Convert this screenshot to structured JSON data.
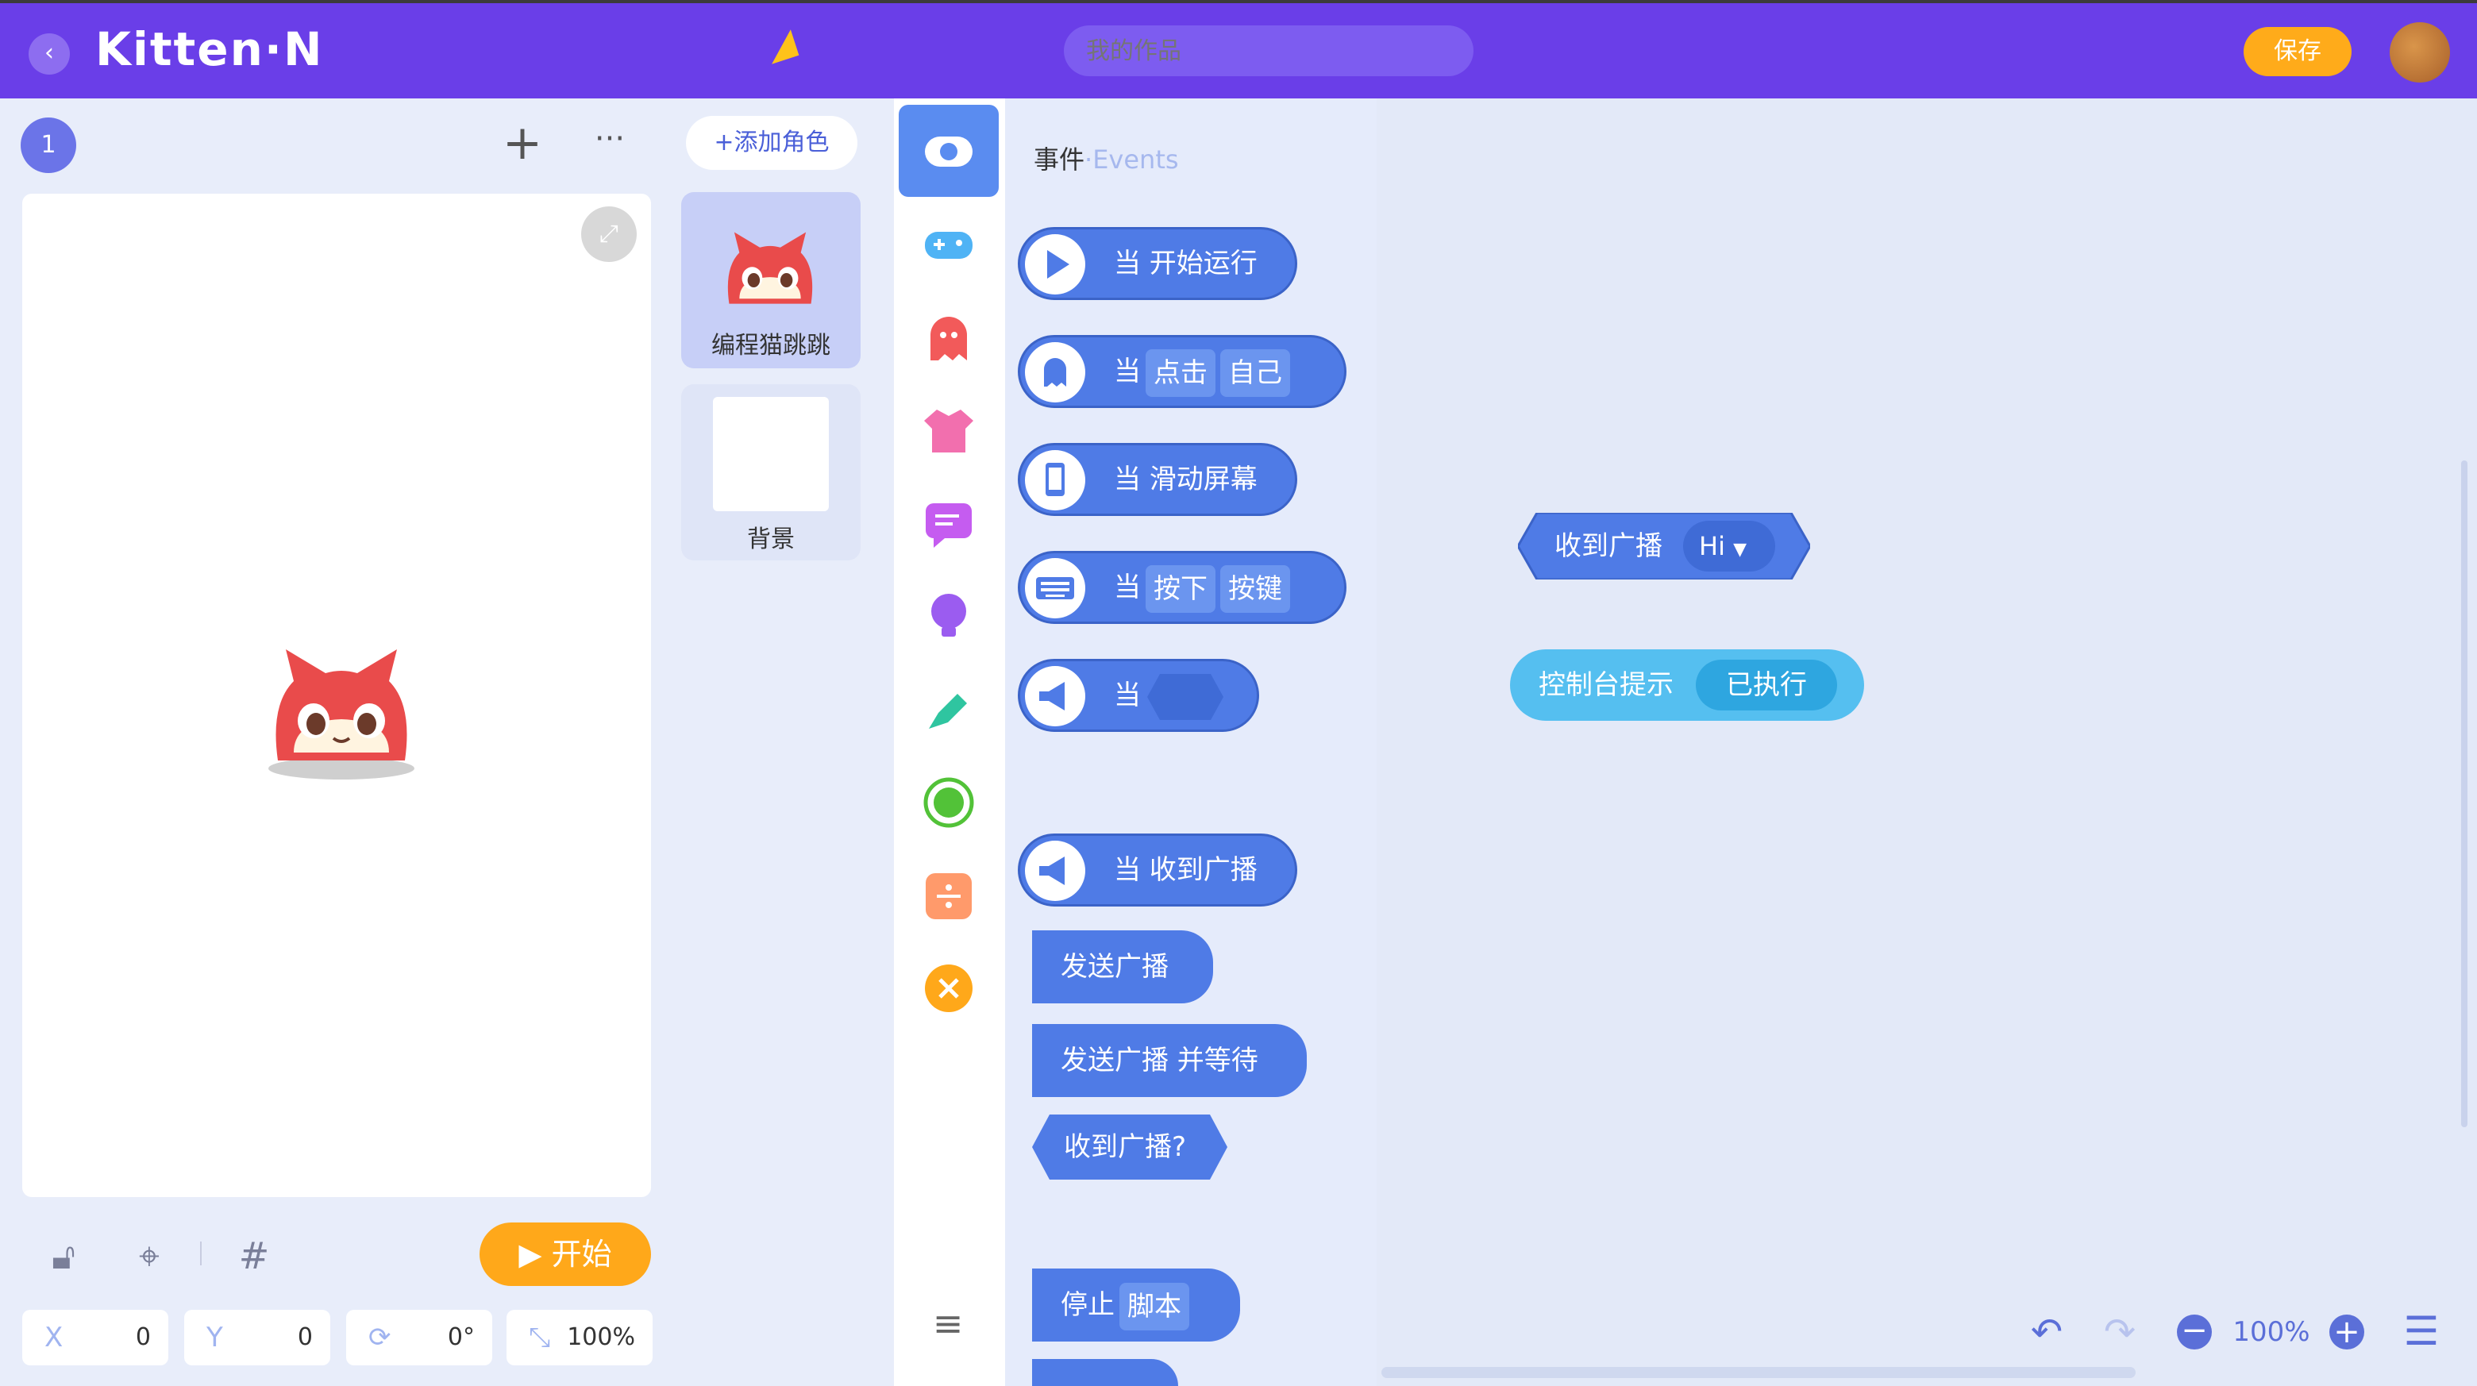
{
  "topbar": {
    "back_icon": "chevron-left-icon",
    "logo": "Kitten·N",
    "work_placeholder": "我的作品",
    "save_label": "保存",
    "avatar": "cookie-avatar"
  },
  "stage_panel": {
    "scene_number": "1",
    "start_label": "开始",
    "x_label": "X",
    "x_value": "0",
    "y_label": "Y",
    "y_value": "0",
    "rotation_value": "0°",
    "scale_value": "100%"
  },
  "sprites": {
    "add_label": "+添加角色",
    "sprite_name": "编程猫跳跳",
    "background_label": "背景"
  },
  "categories": [
    {
      "name": "events-icon",
      "color": "#5a8cf0"
    },
    {
      "name": "gamepad-icon",
      "color": "#4fb3f5"
    },
    {
      "name": "ghost-icon",
      "color": "#f25a5a"
    },
    {
      "name": "shirt-icon",
      "color": "#f26fae"
    },
    {
      "name": "chat-icon",
      "color": "#c55cf0"
    },
    {
      "name": "bulb-icon",
      "color": "#9b5cf0"
    },
    {
      "name": "pen-icon",
      "color": "#2fc5a0"
    },
    {
      "name": "circle-icon",
      "color": "#52c238"
    },
    {
      "name": "divide-icon",
      "color": "#ff9a6b"
    },
    {
      "name": "close-icon",
      "color": "#ffa81a"
    },
    {
      "name": "menu-icon",
      "color": "#666666"
    }
  ],
  "palette": {
    "title": "事件",
    "title_en": "·Events",
    "blocks": {
      "when_start": "当 开始运行",
      "when_click_a": "当",
      "when_click_b": "点击",
      "when_click_c": "自己",
      "when_swipe": "当 滑动屏幕",
      "when_key_a": "当",
      "when_key_b": "按下",
      "when_key_c": "按键",
      "when_broadcast_a": "当",
      "when_receive": "当 收到广播",
      "send_broadcast": "发送广播",
      "send_broadcast_wait": "发送广播 并等待",
      "received_broadcast_q": "收到广播?",
      "stop_a": "停止",
      "stop_b": "脚本"
    }
  },
  "workspace": {
    "broadcast_label": "收到广播",
    "broadcast_value": "Hi",
    "console_label": "控制台提示",
    "console_value": "已执行",
    "zoom": "100%"
  }
}
